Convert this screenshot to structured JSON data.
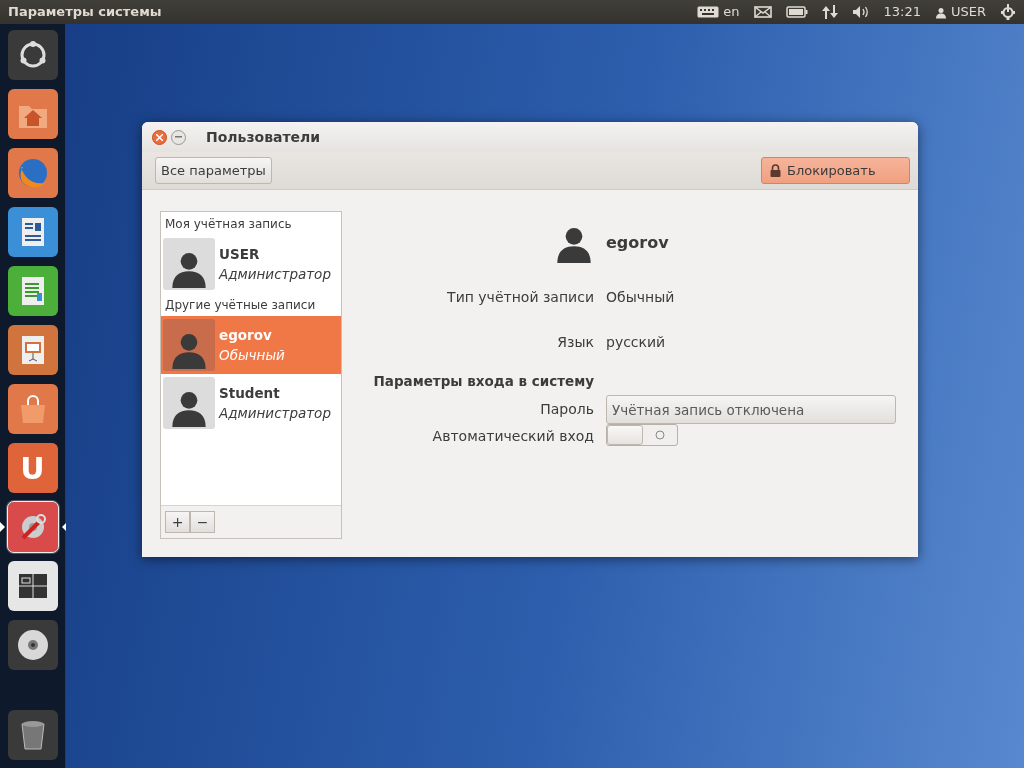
{
  "top_panel": {
    "title": "Параметры системы",
    "language": "en",
    "time": "13:21",
    "user": "USER"
  },
  "launcher": [
    {
      "kind": "dash",
      "focused": false
    },
    {
      "kind": "home",
      "focused": false
    },
    {
      "kind": "browser",
      "focused": false
    },
    {
      "kind": "writer",
      "focused": false
    },
    {
      "kind": "calc",
      "focused": false
    },
    {
      "kind": "impress",
      "focused": false
    },
    {
      "kind": "store",
      "focused": false
    },
    {
      "kind": "letter",
      "letter": "U",
      "focused": false
    },
    {
      "kind": "settings",
      "focused": true
    },
    {
      "kind": "workspaces",
      "focused": false
    },
    {
      "kind": "disc",
      "focused": false
    },
    {
      "kind": "trash",
      "focused": false
    }
  ],
  "window": {
    "title": "Пользователи",
    "all_settings_button": "Все параметры",
    "lock_button": "Блокировать"
  },
  "account_groups": [
    {
      "heading": "Моя учётная запись",
      "users": [
        {
          "name": "USER",
          "role": "Администратор",
          "selected": false
        }
      ]
    },
    {
      "heading": "Другие учётные записи",
      "users": [
        {
          "name": "egorov",
          "role": "Обычный",
          "selected": true
        },
        {
          "name": "Student",
          "role": "Администратор",
          "selected": false
        }
      ]
    }
  ],
  "list_buttons": [
    "+",
    "−"
  ],
  "details": {
    "username": "egorov",
    "fields": [
      {
        "kind": "text",
        "label": "Тип учётной записи",
        "value": "Обычный"
      },
      {
        "kind": "text",
        "label": "Язык",
        "value": "русский"
      },
      {
        "kind": "heading",
        "label": "Параметры входа в систему"
      },
      {
        "kind": "button",
        "label": "Пароль",
        "value": "Учётная запись отключена"
      },
      {
        "kind": "switch",
        "label": "Автоматический вход",
        "on": false
      }
    ]
  }
}
